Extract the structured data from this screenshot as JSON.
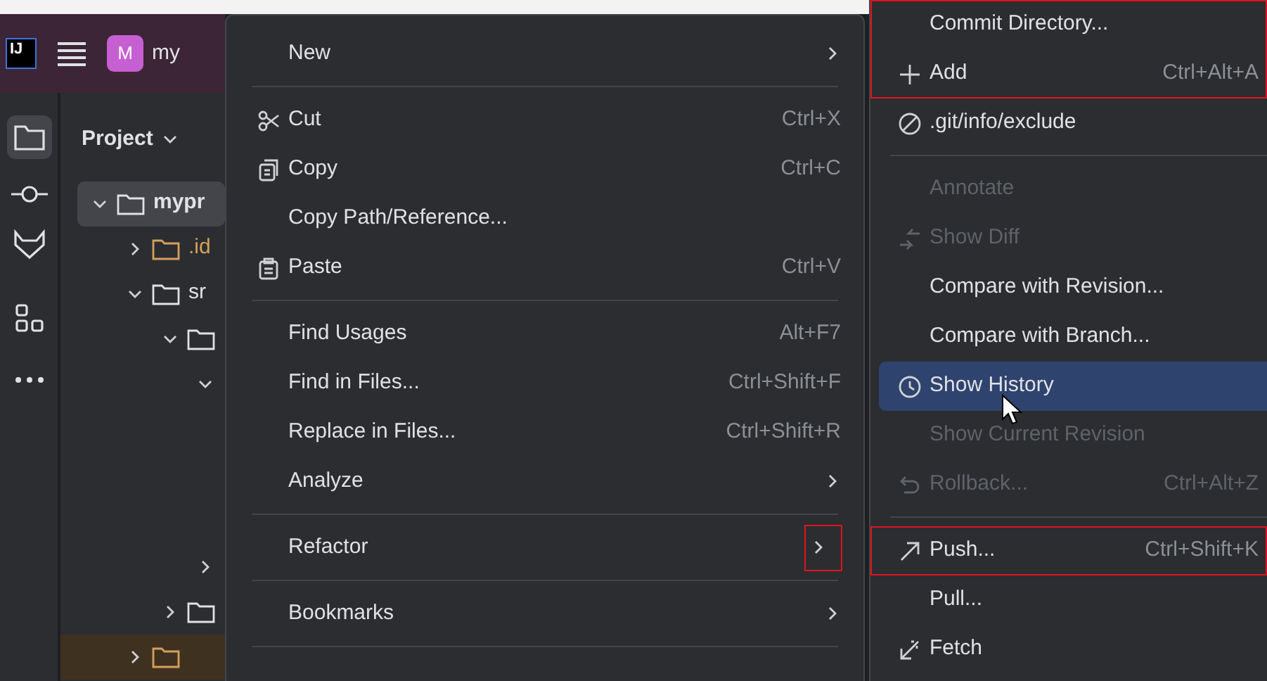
{
  "title_bar": {
    "logo_text": "IJ",
    "avatar_letter": "M",
    "project_name": "my"
  },
  "project_panel": {
    "title": "Project",
    "tree": [
      {
        "label": "mypr",
        "expanded": true,
        "selected": true,
        "color": "#dfe1e5",
        "children": [
          {
            "label": ".id",
            "expanded": false,
            "selected": false,
            "color": "#d5a05b"
          },
          {
            "label": "sr",
            "expanded": true,
            "selected": false,
            "color": "#dfe1e5"
          }
        ]
      }
    ]
  },
  "context_menu": {
    "items": [
      {
        "kind": "item",
        "label": "New",
        "submenu": true,
        "selected": false,
        "disabled": false
      },
      {
        "kind": "separator"
      },
      {
        "kind": "item",
        "label": "Cut",
        "shortcut": "Ctrl+X",
        "submenu": false,
        "selected": false,
        "disabled": false
      },
      {
        "kind": "item",
        "label": "Copy",
        "shortcut": "Ctrl+C",
        "submenu": false,
        "selected": false,
        "disabled": false
      },
      {
        "kind": "item",
        "label": "Copy Path/Reference...",
        "submenu": false,
        "selected": false,
        "disabled": false
      },
      {
        "kind": "item",
        "label": "Paste",
        "shortcut": "Ctrl+V",
        "submenu": false,
        "selected": false,
        "disabled": false
      },
      {
        "kind": "separator"
      },
      {
        "kind": "item",
        "label": "Find Usages",
        "shortcut": "Alt+F7",
        "submenu": false,
        "selected": false,
        "disabled": false
      },
      {
        "kind": "item",
        "label": "Find in Files...",
        "shortcut": "Ctrl+Shift+F",
        "submenu": false,
        "selected": false,
        "disabled": false
      },
      {
        "kind": "item",
        "label": "Replace in Files...",
        "shortcut": "Ctrl+Shift+R",
        "submenu": false,
        "selected": false,
        "disabled": false
      },
      {
        "kind": "item",
        "label": "Analyze",
        "submenu": true,
        "selected": false,
        "disabled": false
      },
      {
        "kind": "separator"
      },
      {
        "kind": "item",
        "label": "Refactor",
        "submenu": true,
        "selected": false,
        "disabled": false,
        "annotated": true
      },
      {
        "kind": "separator"
      },
      {
        "kind": "item",
        "label": "Bookmarks",
        "submenu": true,
        "selected": false,
        "disabled": false
      },
      {
        "kind": "separator"
      }
    ]
  },
  "git_submenu": {
    "items": [
      {
        "kind": "item",
        "label": "Commit Directory...",
        "selected": false,
        "disabled": false,
        "annotated": true
      },
      {
        "kind": "item",
        "label": "Add",
        "shortcut": "Ctrl+Alt+A",
        "selected": false,
        "disabled": false,
        "annotated": true
      },
      {
        "kind": "item",
        "label": ".git/info/exclude",
        "selected": false,
        "disabled": false
      },
      {
        "kind": "separator"
      },
      {
        "kind": "item",
        "label": "Annotate",
        "selected": false,
        "disabled": true
      },
      {
        "kind": "item",
        "label": "Show Diff",
        "selected": false,
        "disabled": true
      },
      {
        "kind": "item",
        "label": "Compare with Revision...",
        "selected": false,
        "disabled": false
      },
      {
        "kind": "item",
        "label": "Compare with Branch...",
        "selected": false,
        "disabled": false
      },
      {
        "kind": "item",
        "label": "Show History",
        "selected": true,
        "disabled": false
      },
      {
        "kind": "item",
        "label": "Show Current Revision",
        "selected": false,
        "disabled": true
      },
      {
        "kind": "item",
        "label": "Rollback...",
        "shortcut": "Ctrl+Alt+Z",
        "selected": false,
        "disabled": true
      },
      {
        "kind": "separator"
      },
      {
        "kind": "item",
        "label": "Push...",
        "shortcut": "Ctrl+Shift+K",
        "selected": false,
        "disabled": false,
        "annotated": true
      },
      {
        "kind": "item",
        "label": "Pull...",
        "selected": false,
        "disabled": false
      },
      {
        "kind": "item",
        "label": "Fetch",
        "selected": false,
        "disabled": false
      }
    ]
  }
}
